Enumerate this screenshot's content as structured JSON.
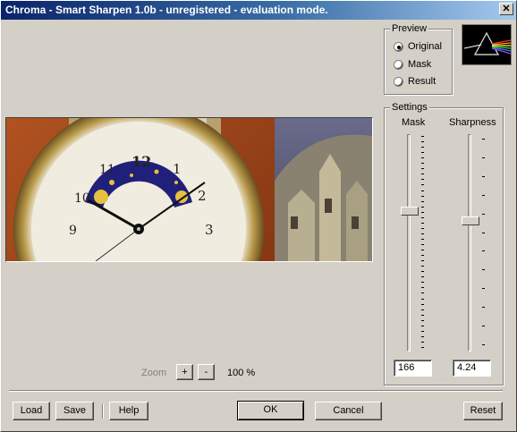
{
  "window": {
    "title": "Chroma - Smart Sharpen 1.0b - unregistered - evaluation mode.",
    "close_glyph": "✕"
  },
  "preview_group": {
    "label": "Preview",
    "options": [
      {
        "label": "Original",
        "checked": true
      },
      {
        "label": "Mask",
        "checked": false
      },
      {
        "label": "Result",
        "checked": false
      }
    ]
  },
  "settings_group": {
    "label": "Settings",
    "mask": {
      "label": "Mask",
      "value": "166"
    },
    "sharpness": {
      "label": "Sharpness",
      "value": "4.24"
    }
  },
  "zoom": {
    "label": "Zoom",
    "plus": "+",
    "minus": "-",
    "value": "100 %"
  },
  "buttons": {
    "load": "Load",
    "save": "Save",
    "help": "Help",
    "ok": "OK",
    "cancel": "Cancel",
    "reset": "Reset"
  },
  "preview_image": {
    "clock_numerals": [
      "12",
      "1",
      "2",
      "3",
      "10",
      "11",
      "9"
    ]
  },
  "colors": {
    "title_start": "#0a246a",
    "title_end": "#a6caf0",
    "face": "#d4d0c8"
  }
}
